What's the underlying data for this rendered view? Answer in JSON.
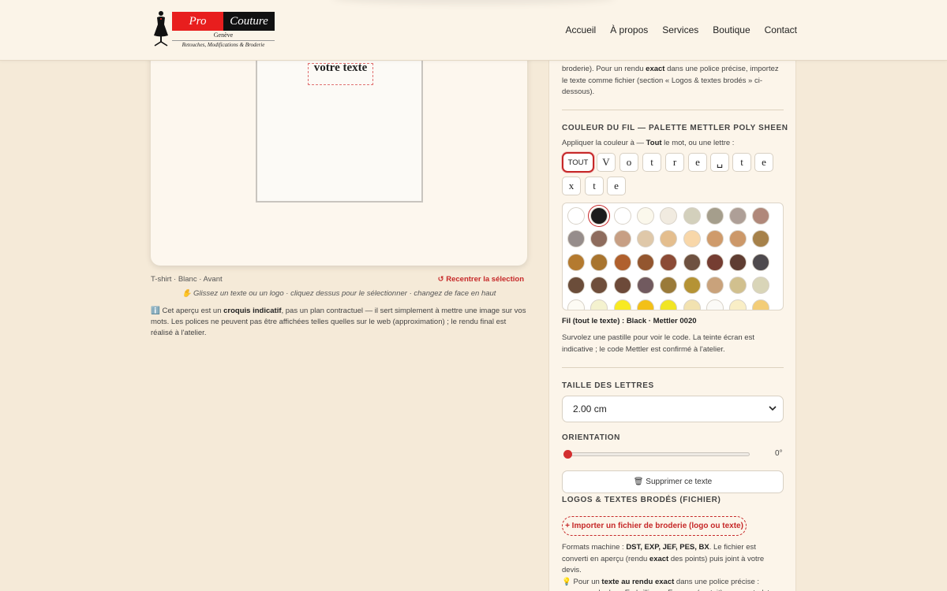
{
  "header": {
    "brand_left": "Pro",
    "brand_right": "Couture",
    "city": "Genève",
    "tagline": "Retouches, Modifications & Broderie",
    "nav": [
      "Accueil",
      "À propos",
      "Services",
      "Boutique",
      "Contact"
    ]
  },
  "preview": {
    "embroidery_text": "votre texte",
    "garment_info": "T-shirt · Blanc · Avant",
    "recenter": "↺ Recentrer la sélection",
    "hint": "✋ Glissez un texte ou un logo · cliquez dessus pour le sélectionner · changez de face en haut",
    "disclaimer_icon": "ℹ️",
    "disclaimer_pre": "Cet aperçu est un ",
    "disclaimer_bold": "croquis indicatif",
    "disclaimer_post": ", pas un plan contractuel — il sert simplement à mettre une image sur vos mots. Les polices ne peuvent pas être affichées telles quelles sur le web (approximation) ; le rendu final est réalisé à l'atelier."
  },
  "panel": {
    "intro_pre": "broderie). Pour un rendu ",
    "intro_bold": "exact",
    "intro_post": " dans une police précise, importez le texte comme fichier (section « Logos & textes brodés » ci-dessous).",
    "color_title": "Couleur du fil — palette Mettler Poly Sheen",
    "apply_pre": "Appliquer la couleur à — ",
    "apply_bold": "Tout",
    "apply_post": " le mot, ou une lettre :",
    "tout_label": "TOUT",
    "letters": [
      "V",
      "o",
      "t",
      "r",
      "e",
      "␣",
      "t",
      "e",
      "x",
      "t",
      "e"
    ],
    "selected_pre": "Fil (tout le texte) : ",
    "selected_name": "Black",
    "selected_code": " · Mettler 0020",
    "hover_hint": "Survolez une pastille pour voir le code. La teinte écran est indicative ; le code Mettler est confirmé à l'atelier.",
    "size_title": "Taille des lettres",
    "size_value": "2.00 cm",
    "orientation_title": "Orientation",
    "orientation_value": "0°",
    "orientation_level": 0,
    "delete_label": "🗑 Supprimer ce texte",
    "logos_title": "Logos & textes brodés (fichier)",
    "import_label": "+ Importer un fichier de broderie (logo ou texte)",
    "formats_pre": "Formats machine : ",
    "formats_bold": "DST, EXP, JEF, PES, BX",
    "formats_mid": ". Le fichier est converti en aperçu (rendu ",
    "formats_bold2": "exact",
    "formats_post": " des points) puis joint à votre devis.",
    "tip_icon": "💡",
    "tip_pre": " Pour un ",
    "tip_bold": "texte au rendu exact",
    "tip_post": " dans une police précise : composez-le dans Embrilliance Express (gratuit) → export .dst →"
  },
  "palette": {
    "selected_index": 1,
    "rows": [
      [
        "#ffffff",
        "#1c1c1c",
        "#ffffff",
        "#fbf8ec",
        "#f1ebe0",
        "#d3d0bc",
        "#a59e8c",
        "#ae9f97",
        "#b0887a"
      ],
      [
        "#968d8b",
        "#8e6c5d",
        "#c79f84",
        "#dfc8a9",
        "#e4be8e",
        "#f8d7a9",
        "#cf9b6b",
        "#cc9869",
        "#a6814a"
      ],
      [
        "#b47a2f",
        "#a8742e",
        "#b0602d",
        "#93562f",
        "#8b4b36",
        "#6e5140",
        "#753d32",
        "#5f3d32",
        "#4e4a4e"
      ],
      [
        "#6b4d3a",
        "#6f4e3b",
        "#6d4a39",
        "#715a5f",
        "#9a7a39",
        "#b59335",
        "#c9a27b",
        "#d1c08e",
        "#d9d5b8"
      ],
      [
        "#fdfbf4",
        "#f4f2cf",
        "#f8ea22",
        "#f3c018",
        "#f1e524",
        "#f2e2b0",
        "#fbfaf7",
        "#f9eec6",
        "#f3cd78"
      ]
    ]
  },
  "colors": {
    "accent_red": "#c62828",
    "page_bg": "#f5ead8",
    "panel_bg": "#fcf5ea"
  }
}
